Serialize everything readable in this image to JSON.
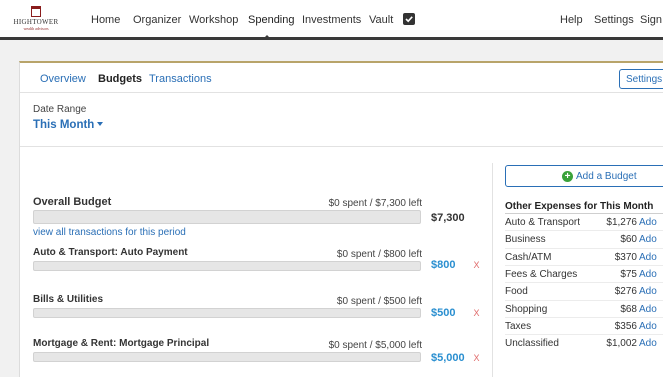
{
  "logo": {
    "name": "HIGHTOWER",
    "tagline": "wealth advisors"
  },
  "nav": {
    "items": [
      "Home",
      "Organizer",
      "Workshop",
      "Spending",
      "Investments",
      "Vault"
    ],
    "right": [
      "Help",
      "Settings",
      "Sign"
    ]
  },
  "tabs": [
    "Overview",
    "Budgets",
    "Transactions"
  ],
  "settings_label": "Settings",
  "date_range": {
    "label": "Date Range",
    "value": "This Month"
  },
  "overall": {
    "name": "Overall Budget",
    "status": "$0 spent / $7,300 left",
    "amount": "$7,300",
    "spent_fraction": 0
  },
  "view_link": "view all transactions for this period",
  "budgets": [
    {
      "name": "Auto & Transport: Auto Payment",
      "status": "$0 spent / $800 left",
      "amount": "$800",
      "spent_fraction": 0
    },
    {
      "name": "Bills & Utilities",
      "status": "$0 spent / $500 left",
      "amount": "$500",
      "spent_fraction": 0
    },
    {
      "name": "Mortgage & Rent: Mortgage Principal",
      "status": "$0 spent / $5,000 left",
      "amount": "$5,000",
      "spent_fraction": 0
    }
  ],
  "remove_glyph": "X",
  "add_budget_label": "Add a Budget",
  "other_expenses": {
    "title": "Other Expenses for This Month",
    "add_label": "Ado",
    "rows": [
      {
        "category": "Auto & Transport",
        "amount": "$1,276"
      },
      {
        "category": "Business",
        "amount": "$60"
      },
      {
        "category": "Cash/ATM",
        "amount": "$370"
      },
      {
        "category": "Fees & Charges",
        "amount": "$75"
      },
      {
        "category": "Food",
        "amount": "$276"
      },
      {
        "category": "Shopping",
        "amount": "$68"
      },
      {
        "category": "Taxes",
        "amount": "$356"
      },
      {
        "category": "Unclassified",
        "amount": "$1,002"
      }
    ]
  },
  "colors": {
    "link": "#2a6fb6",
    "amount_blue": "#2a8fd0",
    "add_green": "#3aa23a",
    "remove_red": "#e06a6a",
    "brand": "#8a1c1c"
  },
  "icons": {
    "vault": "checkbox-icon",
    "add": "plus-circle-icon",
    "remove": "close-icon"
  }
}
